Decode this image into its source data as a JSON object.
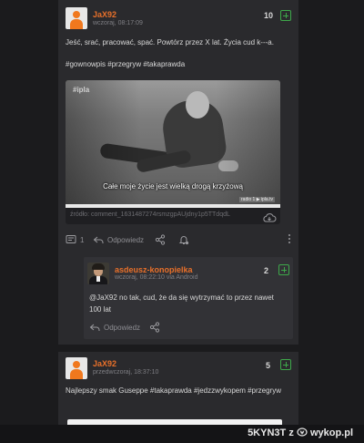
{
  "posts": [
    {
      "username": "JaX92",
      "timestamp": "wczoraj, 08:17:09",
      "votes": "10",
      "text": "Jeść, srać, pracować, spać. Powtórz przez X lat. Życia cud k---a.",
      "tags": "#gownowpis #przegryw #takaprawda",
      "embed": {
        "logo": "#ipla",
        "subtitle": "Całe moje życie jest wielką drogą krzyżową",
        "watermark": "radio   1 ▶ ipla.tv",
        "source": "źródło: comment_1631487274rsmzgpAUjdny1p5TTdqdL"
      },
      "actions": {
        "comments_count": "1",
        "reply_label": "Odpowiedz"
      },
      "reply": {
        "username": "asdeusz-konopielka",
        "timestamp": "wczoraj, 08:22:10",
        "via": "via Android",
        "votes": "2",
        "text": "@JaX92 no tak, cud, że da się wytrzymać to przez nawet 100 lat",
        "reply_label": "Odpowiedz"
      }
    },
    {
      "username": "JaX92",
      "timestamp": "przedwczoraj, 18:37:10",
      "votes": "5",
      "text": "Najlepszy smak Guseppe #takaprawda #jedzzwykopem #przegryw"
    }
  ],
  "footer": {
    "user": "5KYN3T",
    "separator": "z",
    "site": "wykop.pl"
  },
  "colors": {
    "accent": "#e8702a",
    "vote_green": "#3ea84a",
    "background": "#1b1b1d",
    "card": "#2a2a2d"
  }
}
